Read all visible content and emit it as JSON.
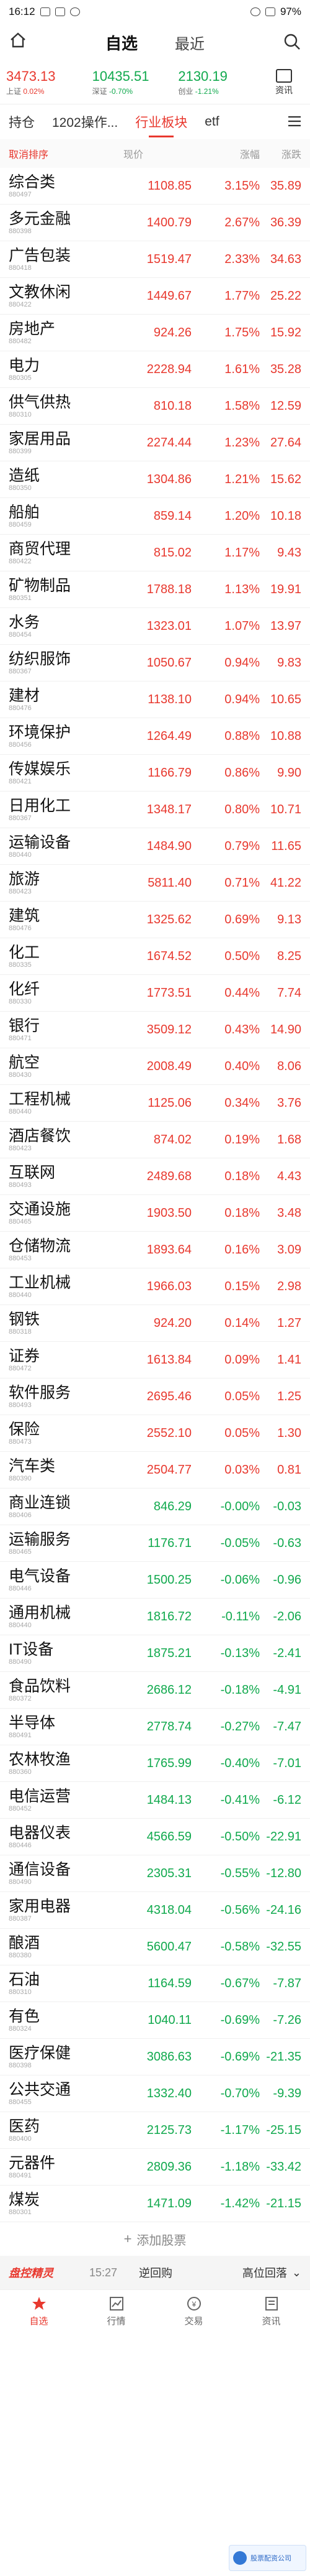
{
  "status": {
    "time": "16:12",
    "battery": "97%"
  },
  "header": {
    "title": "自选",
    "recent": "最近"
  },
  "indices": [
    {
      "value": "3473.13",
      "name": "上证",
      "change": "0.02%",
      "color": "red"
    },
    {
      "value": "10435.51",
      "name": "深证",
      "change": "-0.70%",
      "color": "green"
    },
    {
      "value": "2130.19",
      "name": "创业",
      "change": "-1.21%",
      "color": "green"
    }
  ],
  "message_label": "资讯",
  "tabs": [
    "持仓",
    "1202操作...",
    "行业板块",
    "etf"
  ],
  "columns": {
    "sort": "取消排序",
    "price": "现价",
    "change": "涨幅",
    "speed": "涨跌"
  },
  "rows": [
    {
      "name": "综合类",
      "code": "880497",
      "price": "1108.85",
      "change": "3.15%",
      "speed": "35.89",
      "dir": "red",
      "nc": "black"
    },
    {
      "name": "多元金融",
      "code": "880398",
      "price": "1400.79",
      "change": "2.67%",
      "speed": "36.39",
      "dir": "red",
      "nc": "black"
    },
    {
      "name": "广告包装",
      "code": "880418",
      "price": "1519.47",
      "change": "2.33%",
      "speed": "34.63",
      "dir": "red",
      "nc": "black"
    },
    {
      "name": "文教休闲",
      "code": "880422",
      "price": "1449.67",
      "change": "1.77%",
      "speed": "25.22",
      "dir": "red",
      "nc": "black"
    },
    {
      "name": "房地产",
      "code": "880482",
      "price": "924.26",
      "change": "1.75%",
      "speed": "15.92",
      "dir": "red",
      "nc": "teal"
    },
    {
      "name": "电力",
      "code": "880305",
      "price": "2228.94",
      "change": "1.61%",
      "speed": "35.28",
      "dir": "red",
      "nc": "black"
    },
    {
      "name": "供气供热",
      "code": "880310",
      "price": "810.18",
      "change": "1.58%",
      "speed": "12.59",
      "dir": "red",
      "nc": "black"
    },
    {
      "name": "家居用品",
      "code": "880399",
      "price": "2274.44",
      "change": "1.23%",
      "speed": "27.64",
      "dir": "red",
      "nc": "black"
    },
    {
      "name": "造纸",
      "code": "880350",
      "price": "1304.86",
      "change": "1.21%",
      "speed": "15.62",
      "dir": "red",
      "nc": "black"
    },
    {
      "name": "船舶",
      "code": "880459",
      "price": "859.14",
      "change": "1.20%",
      "speed": "10.18",
      "dir": "red",
      "nc": "black"
    },
    {
      "name": "商贸代理",
      "code": "880422",
      "price": "815.02",
      "change": "1.17%",
      "speed": "9.43",
      "dir": "red",
      "nc": "black"
    },
    {
      "name": "矿物制品",
      "code": "880351",
      "price": "1788.18",
      "change": "1.13%",
      "speed": "19.91",
      "dir": "red",
      "nc": "teal"
    },
    {
      "name": "水务",
      "code": "880454",
      "price": "1323.01",
      "change": "1.07%",
      "speed": "13.97",
      "dir": "red",
      "nc": "black"
    },
    {
      "name": "纺织服饰",
      "code": "880367",
      "price": "1050.67",
      "change": "0.94%",
      "speed": "9.83",
      "dir": "red",
      "nc": "black"
    },
    {
      "name": "建材",
      "code": "880476",
      "price": "1138.10",
      "change": "0.94%",
      "speed": "10.65",
      "dir": "red",
      "nc": "black"
    },
    {
      "name": "环境保护",
      "code": "880456",
      "price": "1264.49",
      "change": "0.88%",
      "speed": "10.88",
      "dir": "red",
      "nc": "black"
    },
    {
      "name": "传媒娱乐",
      "code": "880421",
      "price": "1166.79",
      "change": "0.86%",
      "speed": "9.90",
      "dir": "red",
      "nc": "teal"
    },
    {
      "name": "日用化工",
      "code": "880367",
      "price": "1348.17",
      "change": "0.80%",
      "speed": "10.71",
      "dir": "red",
      "nc": "black"
    },
    {
      "name": "运输设备",
      "code": "880440",
      "price": "1484.90",
      "change": "0.79%",
      "speed": "11.65",
      "dir": "red",
      "nc": "black"
    },
    {
      "name": "旅游",
      "code": "880423",
      "price": "5811.40",
      "change": "0.71%",
      "speed": "41.22",
      "dir": "red",
      "nc": "teal"
    },
    {
      "name": "建筑",
      "code": "880476",
      "price": "1325.62",
      "change": "0.69%",
      "speed": "9.13",
      "dir": "red",
      "nc": "teal"
    },
    {
      "name": "化工",
      "code": "880335",
      "price": "1674.52",
      "change": "0.50%",
      "speed": "8.25",
      "dir": "red",
      "nc": "black"
    },
    {
      "name": "化纤",
      "code": "880330",
      "price": "1773.51",
      "change": "0.44%",
      "speed": "7.74",
      "dir": "red",
      "nc": "black"
    },
    {
      "name": "银行",
      "code": "880471",
      "price": "3509.12",
      "change": "0.43%",
      "speed": "14.90",
      "dir": "red",
      "nc": "teal"
    },
    {
      "name": "航空",
      "code": "880430",
      "price": "2008.49",
      "change": "0.40%",
      "speed": "8.06",
      "dir": "red",
      "nc": "teal"
    },
    {
      "name": "工程机械",
      "code": "880440",
      "price": "1125.06",
      "change": "0.34%",
      "speed": "3.76",
      "dir": "red",
      "nc": "black"
    },
    {
      "name": "酒店餐饮",
      "code": "880423",
      "price": "874.02",
      "change": "0.19%",
      "speed": "1.68",
      "dir": "red",
      "nc": "black"
    },
    {
      "name": "互联网",
      "code": "880493",
      "price": "2489.68",
      "change": "0.18%",
      "speed": "4.43",
      "dir": "red",
      "nc": "black"
    },
    {
      "name": "交通设施",
      "code": "880465",
      "price": "1903.50",
      "change": "0.18%",
      "speed": "3.48",
      "dir": "red",
      "nc": "black"
    },
    {
      "name": "仓储物流",
      "code": "880453",
      "price": "1893.64",
      "change": "0.16%",
      "speed": "3.09",
      "dir": "red",
      "nc": "black"
    },
    {
      "name": "工业机械",
      "code": "880440",
      "price": "1966.03",
      "change": "0.15%",
      "speed": "2.98",
      "dir": "red",
      "nc": "black"
    },
    {
      "name": "钢铁",
      "code": "880318",
      "price": "924.20",
      "change": "0.14%",
      "speed": "1.27",
      "dir": "red",
      "nc": "black"
    },
    {
      "name": "证券",
      "code": "880472",
      "price": "1613.84",
      "change": "0.09%",
      "speed": "1.41",
      "dir": "red",
      "nc": "black"
    },
    {
      "name": "软件服务",
      "code": "880493",
      "price": "2695.46",
      "change": "0.05%",
      "speed": "1.25",
      "dir": "red",
      "nc": "black"
    },
    {
      "name": "保险",
      "code": "880473",
      "price": "2552.10",
      "change": "0.05%",
      "speed": "1.30",
      "dir": "red",
      "nc": "black"
    },
    {
      "name": "汽车类",
      "code": "880390",
      "price": "2504.77",
      "change": "0.03%",
      "speed": "0.81",
      "dir": "red",
      "nc": "teal"
    },
    {
      "name": "商业连锁",
      "code": "880406",
      "price": "846.29",
      "change": "-0.00%",
      "speed": "-0.03",
      "dir": "green",
      "nc": "black"
    },
    {
      "name": "运输服务",
      "code": "880465",
      "price": "1176.71",
      "change": "-0.05%",
      "speed": "-0.63",
      "dir": "green",
      "nc": "black"
    },
    {
      "name": "电气设备",
      "code": "880446",
      "price": "1500.25",
      "change": "-0.06%",
      "speed": "-0.96",
      "dir": "green",
      "nc": "teal"
    },
    {
      "name": "通用机械",
      "code": "880440",
      "price": "1816.72",
      "change": "-0.11%",
      "speed": "-2.06",
      "dir": "green",
      "nc": "teal"
    },
    {
      "name": "IT设备",
      "code": "880490",
      "price": "1875.21",
      "change": "-0.13%",
      "speed": "-2.41",
      "dir": "green",
      "nc": "black"
    },
    {
      "name": "食品饮料",
      "code": "880372",
      "price": "2686.12",
      "change": "-0.18%",
      "speed": "-4.91",
      "dir": "green",
      "nc": "black"
    },
    {
      "name": "半导体",
      "code": "880491",
      "price": "2778.74",
      "change": "-0.27%",
      "speed": "-7.47",
      "dir": "green",
      "nc": "teal"
    },
    {
      "name": "农林牧渔",
      "code": "880360",
      "price": "1765.99",
      "change": "-0.40%",
      "speed": "-7.01",
      "dir": "green",
      "nc": "teal"
    },
    {
      "name": "电信运营",
      "code": "880452",
      "price": "1484.13",
      "change": "-0.41%",
      "speed": "-6.12",
      "dir": "green",
      "nc": "teal"
    },
    {
      "name": "电器仪表",
      "code": "880446",
      "price": "4566.59",
      "change": "-0.50%",
      "speed": "-22.91",
      "dir": "green",
      "nc": "black"
    },
    {
      "name": "通信设备",
      "code": "880490",
      "price": "2305.31",
      "change": "-0.55%",
      "speed": "-12.80",
      "dir": "green",
      "nc": "black"
    },
    {
      "name": "家用电器",
      "code": "880387",
      "price": "4318.04",
      "change": "-0.56%",
      "speed": "-24.16",
      "dir": "green",
      "nc": "black"
    },
    {
      "name": "酿酒",
      "code": "880380",
      "price": "5600.47",
      "change": "-0.58%",
      "speed": "-32.55",
      "dir": "green",
      "nc": "teal"
    },
    {
      "name": "石油",
      "code": "880310",
      "price": "1164.59",
      "change": "-0.67%",
      "speed": "-7.87",
      "dir": "green",
      "nc": "black"
    },
    {
      "name": "有色",
      "code": "880324",
      "price": "1040.11",
      "change": "-0.69%",
      "speed": "-7.26",
      "dir": "green",
      "nc": "teal"
    },
    {
      "name": "医疗保健",
      "code": "880398",
      "price": "3086.63",
      "change": "-0.69%",
      "speed": "-21.35",
      "dir": "green",
      "nc": "teal"
    },
    {
      "name": "公共交通",
      "code": "880455",
      "price": "1332.40",
      "change": "-0.70%",
      "speed": "-9.39",
      "dir": "green",
      "nc": "black"
    },
    {
      "name": "医药",
      "code": "880400",
      "price": "2125.73",
      "change": "-1.17%",
      "speed": "-25.15",
      "dir": "green",
      "nc": "black"
    },
    {
      "name": "元器件",
      "code": "880491",
      "price": "2809.36",
      "change": "-1.18%",
      "speed": "-33.42",
      "dir": "green",
      "nc": "teal"
    },
    {
      "name": "煤炭",
      "code": "880301",
      "price": "1471.09",
      "change": "-1.42%",
      "speed": "-21.15",
      "dir": "green",
      "nc": "teal"
    }
  ],
  "add_stock": "添加股票",
  "footer": {
    "brand": "盘控精灵",
    "time": "15:27",
    "back": "逆回购",
    "sort": "高位回落"
  },
  "nav": [
    {
      "label": "自选",
      "active": true
    },
    {
      "label": "行情",
      "active": false
    },
    {
      "label": "交易",
      "active": false
    },
    {
      "label": "资讯",
      "active": false
    }
  ],
  "watermark": "股票配资公司"
}
